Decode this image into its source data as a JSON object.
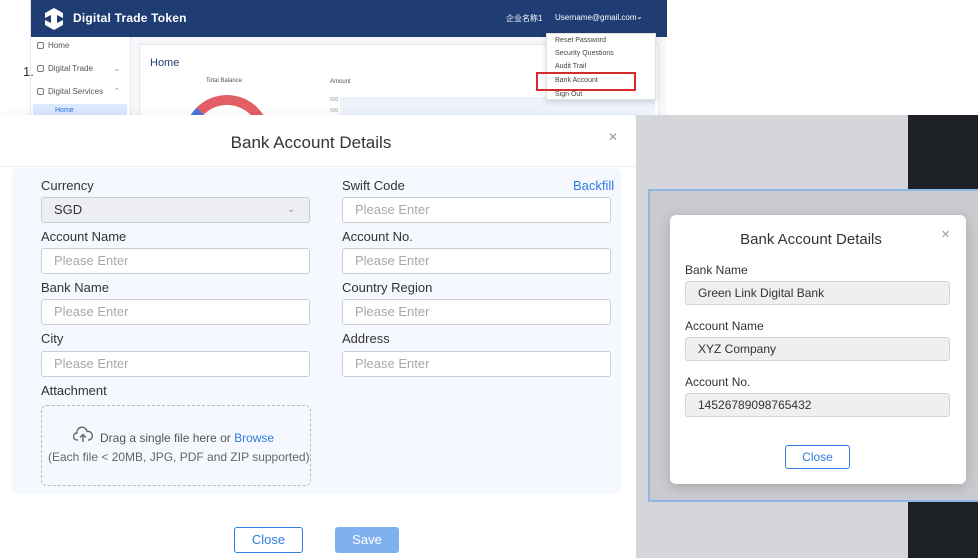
{
  "app": {
    "title": "Digital Trade Token",
    "company": "企业名称1",
    "user": "Username@gmail.com",
    "sidebar": [
      {
        "label": "Home"
      },
      {
        "label": "Digital Trade"
      },
      {
        "label": "Digital Services"
      }
    ],
    "sidebar_active": "Home",
    "main_title": "Home",
    "total_balance_label": "Total Balance",
    "amount_label": "Amount",
    "tick_a": "600",
    "tick_b": "500",
    "dropdown": [
      {
        "label": "Reset Password"
      },
      {
        "label": "Security Questions"
      },
      {
        "label": "Audit Trail"
      },
      {
        "label": "Bank Account"
      },
      {
        "label": "Sign Out"
      }
    ]
  },
  "form_modal": {
    "title": "Bank Account Details",
    "close_icon": "close-icon",
    "row_number": "1.",
    "backfill": "Backfill",
    "fields": {
      "currency": {
        "label": "Currency",
        "value": "SGD"
      },
      "swift_code": {
        "label": "Swift Code",
        "placeholder": "Please Enter"
      },
      "account_name": {
        "label": "Account Name",
        "placeholder": "Please Enter"
      },
      "account_no": {
        "label": "Account No.",
        "placeholder": "Please Enter"
      },
      "bank_name": {
        "label": "Bank Name",
        "placeholder": "Please Enter"
      },
      "country_region": {
        "label": "Country Region",
        "placeholder": "Please Enter"
      },
      "city": {
        "label": "City",
        "placeholder": "Please Enter"
      },
      "address": {
        "label": "Address",
        "placeholder": "Please Enter"
      }
    },
    "attachment": {
      "label": "Attachment",
      "drag_text": "Drag a single file here or ",
      "browse": "Browse",
      "hint": "(Each file < 20MB, JPG, PDF and ZIP supported)"
    },
    "close_button": "Close",
    "save_button": "Save"
  },
  "detail_modal": {
    "title": "Bank Account Details",
    "bank_name_label": "Bank Name",
    "bank_name_value": "Green Link Digital Bank",
    "account_name_label": "Account Name",
    "account_name_value": "XYZ Company",
    "account_no_label": "Account No.",
    "account_no_value": "14526789098765432",
    "close_button": "Close"
  },
  "colors": {
    "header": "#1f3c73",
    "accent": "#2f7ce0",
    "save": "#7fb0ef",
    "highlight": "#d62b2b"
  }
}
